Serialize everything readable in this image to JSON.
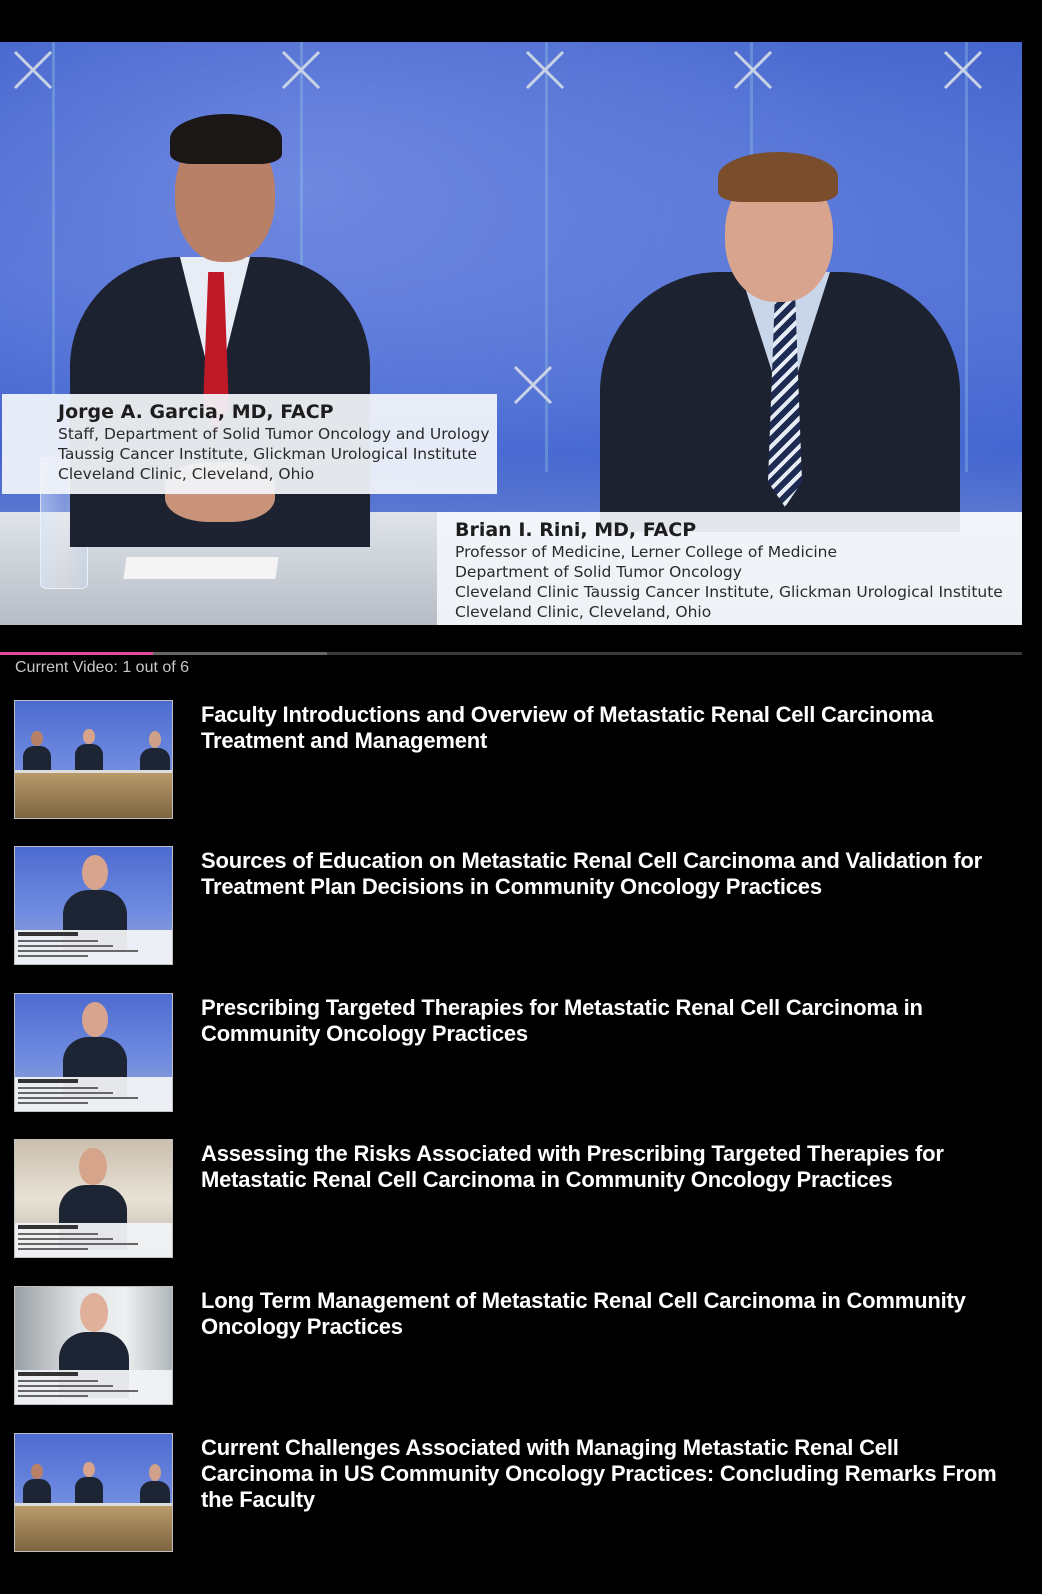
{
  "player": {
    "speaker1": {
      "name": "Jorge A. Garcia, MD, FACP",
      "lines": [
        "Staff, Department of Solid Tumor Oncology and Urology",
        "Taussig Cancer Institute, Glickman Urological Institute",
        "Cleveland Clinic, Cleveland, Ohio"
      ]
    },
    "speaker2": {
      "name": "Brian I. Rini, MD, FACP",
      "lines": [
        "Professor of Medicine, Lerner College of Medicine",
        "Department of Solid Tumor Oncology",
        "Cleveland Clinic Taussig Cancer Institute, Glickman Urological Institute",
        "Cleveland Clinic, Cleveland, Ohio"
      ]
    },
    "progress_fraction": 0.15,
    "loaded_fraction": 0.32,
    "accent_color": "#e04aa0"
  },
  "current_video": "Current Video: 1 out of 6",
  "playlist": [
    {
      "title": "Faculty Introductions and Overview of Metastatic Renal Cell Carcinoma Treatment and Management",
      "thumb": "panel"
    },
    {
      "title": "Sources of Education on Metastatic Renal Cell Carcinoma and Validation for Treatment Plan Decisions in Community Oncology Practices",
      "thumb": "speaker-blue"
    },
    {
      "title": "Prescribing Targeted Therapies for Metastatic Renal Cell Carcinoma in Community Oncology Practices",
      "thumb": "speaker-blue"
    },
    {
      "title": "Assessing the Risks Associated with Prescribing Targeted Therapies for Metastatic Renal Cell Carcinoma in Community Oncology Practices",
      "thumb": "speaker-room"
    },
    {
      "title": "Long Term Management of Metastatic Renal Cell Carcinoma in Community Oncology Practices",
      "thumb": "speaker-office"
    },
    {
      "title": "Current Challenges Associated with Managing Metastatic Renal Cell Carcinoma in US Community Oncology Practices: Concluding Remarks From the Faculty",
      "thumb": "panel"
    }
  ]
}
